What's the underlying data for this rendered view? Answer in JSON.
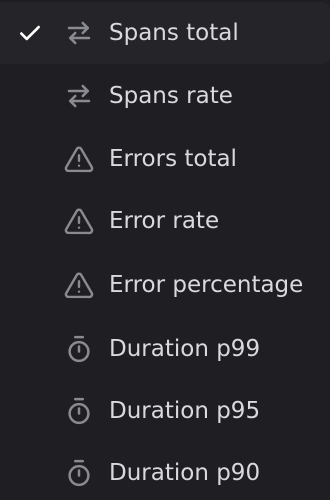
{
  "menu": {
    "items": [
      {
        "label": "Spans total",
        "icon": "arrows-swap-icon",
        "selected": true
      },
      {
        "label": "Spans rate",
        "icon": "arrows-swap-icon",
        "selected": false
      },
      {
        "label": "Errors total",
        "icon": "warning-triangle-icon",
        "selected": false
      },
      {
        "label": "Error rate",
        "icon": "warning-triangle-icon",
        "selected": false
      },
      {
        "label": "Error percentage",
        "icon": "warning-triangle-icon",
        "selected": false
      },
      {
        "label": "Duration p99",
        "icon": "stopwatch-icon",
        "selected": false
      },
      {
        "label": "Duration p95",
        "icon": "stopwatch-icon",
        "selected": false
      },
      {
        "label": "Duration p90",
        "icon": "stopwatch-icon",
        "selected": false
      }
    ]
  },
  "colors": {
    "background": "#1f1f23",
    "selected_background": "#252529",
    "text": "#d9d9de",
    "icon": "#8a8a91",
    "check": "#ffffff"
  }
}
